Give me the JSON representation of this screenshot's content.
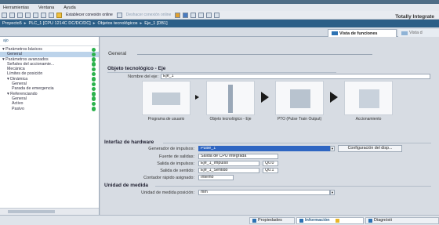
{
  "menubar": {
    "items": [
      "Herramientas",
      "Ventana",
      "Ayuda"
    ]
  },
  "toolbar": {
    "connect_online": "Establecer conexión online",
    "disconnect_online": "Deshacer conexión online",
    "brand": "Totally Integrate"
  },
  "breadcrumb": [
    "Proyecto5",
    "PLC_1 [CPU 1214C DC/DC/DC]",
    "Objetos tecnológicos",
    "Eje_1 [DB1]"
  ],
  "views": {
    "active": "Vista de funciones",
    "other": "Vista d"
  },
  "left_pane": {
    "header": "ajo",
    "tree": [
      {
        "label": "Parámetros básicos",
        "indent": 0,
        "expander": true,
        "selected": false,
        "check": true
      },
      {
        "label": "General",
        "indent": 1,
        "expander": false,
        "selected": true,
        "check": true
      },
      {
        "label": "Parámetros avanzados",
        "indent": 0,
        "expander": true,
        "selected": false,
        "check": true
      },
      {
        "label": "Señales del accionamie...",
        "indent": 1,
        "expander": false,
        "selected": false,
        "check": true
      },
      {
        "label": "Mecánica",
        "indent": 1,
        "expander": false,
        "selected": false,
        "check": true
      },
      {
        "label": "Límites de posición",
        "indent": 1,
        "expander": false,
        "selected": false,
        "check": true
      },
      {
        "label": "Dinámica",
        "indent": 1,
        "expander": true,
        "selected": false,
        "check": true
      },
      {
        "label": "General",
        "indent": 2,
        "expander": false,
        "selected": false,
        "check": true
      },
      {
        "label": "Parada de emergencia",
        "indent": 2,
        "expander": false,
        "selected": false,
        "check": true
      },
      {
        "label": "Referenciando",
        "indent": 1,
        "expander": true,
        "selected": false,
        "check": true
      },
      {
        "label": "General",
        "indent": 2,
        "expander": false,
        "selected": false,
        "check": true
      },
      {
        "label": "Activo",
        "indent": 2,
        "expander": false,
        "selected": false,
        "check": true
      },
      {
        "label": "Pasivo",
        "indent": 2,
        "expander": false,
        "selected": false,
        "check": true
      }
    ]
  },
  "main": {
    "section_general": "General",
    "tech_object": {
      "title": "Objeto tecnológico - Eje",
      "axis_name_label": "Nombre del eje:",
      "axis_name_value": "Eje_1"
    },
    "diagram": [
      {
        "caption": "Programa de usuario"
      },
      {
        "caption": "Objeto tecnológico - Eje"
      },
      {
        "caption": "PTO (Pulse Train Output)"
      },
      {
        "caption": "Accionamiento"
      }
    ],
    "hardware": {
      "title": "Interfaz de hardware",
      "pulse_gen_label": "Generador de impulsos:",
      "pulse_gen_value": "Pulse_1",
      "config_button": "Configuración del disp...",
      "output_source_label": "Fuente de salidas:",
      "output_source_value": "Salida de CPU integrada",
      "pulse_out_label": "Salida de impulsos:",
      "pulse_out_value": "Eje_1_Impulso",
      "pulse_out_addr": "Q0.0",
      "dir_out_label": "Salida de sentido:",
      "dir_out_value": "Eje_1_Sentido",
      "dir_out_addr": "Q0.1",
      "hsc_label": "Contador rápido asignado:",
      "hsc_value": "Interno"
    },
    "units": {
      "title": "Unidad de medida",
      "pos_unit_label": "Unidad de medida posición:",
      "pos_unit_value": "mm"
    }
  },
  "statusbar": {
    "properties": "Propiedades",
    "info": "Información",
    "diagnostics": "Diagnósti"
  }
}
